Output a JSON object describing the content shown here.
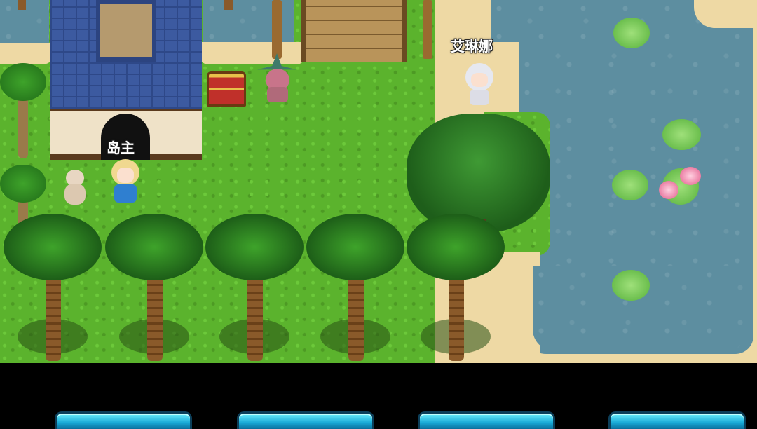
{
  "npcs": [
    {
      "id": "island-owner",
      "label": "岛主"
    },
    {
      "id": "irina",
      "label": "艾琳娜"
    }
  ],
  "colors": {
    "water": "#5d8ea0",
    "sand": "#eed9a4",
    "grass": "#5bb32d",
    "roof": "#3c5aa0",
    "button": "#17a9d6"
  },
  "bottom_bar": {
    "buttons": [
      {
        "label": ""
      },
      {
        "label": ""
      },
      {
        "label": ""
      },
      {
        "label": ""
      }
    ]
  }
}
